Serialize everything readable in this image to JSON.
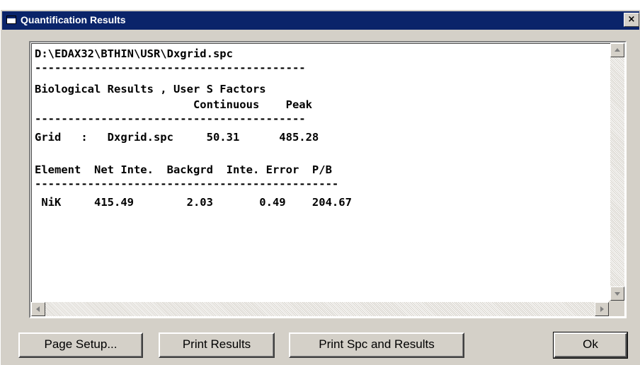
{
  "window": {
    "title": "Quantification Results",
    "close_glyph": "×"
  },
  "results": {
    "lines": [
      "D:\\EDAX32\\BTHIN\\USR\\Dxgrid.spc",
      "-----------------------------------------",
      "Biological Results , User S Factors",
      "                        Continuous    Peak",
      "-----------------------------------------",
      "Grid   :   Dxgrid.spc     50.31      485.28",
      "",
      "Element  Net Inte.  Backgrd  Inte. Error  P/B",
      "----------------------------------------------",
      " NiK     415.49        2.03       0.49    204.67"
    ]
  },
  "scrollbars": {
    "vertical": {
      "up_icon": "arrow-up-icon",
      "down_icon": "arrow-down-icon"
    },
    "horizontal": {
      "left_icon": "arrow-left-icon",
      "right_icon": "arrow-right-icon"
    }
  },
  "buttons": {
    "page_setup": "Page Setup...",
    "print_results": "Print Results",
    "print_spc_and_results": "Print Spc and Results",
    "ok": "Ok"
  },
  "colors": {
    "titlebar": "#0a246a",
    "face": "#d4d0c8",
    "text_bg": "#ffffff"
  }
}
